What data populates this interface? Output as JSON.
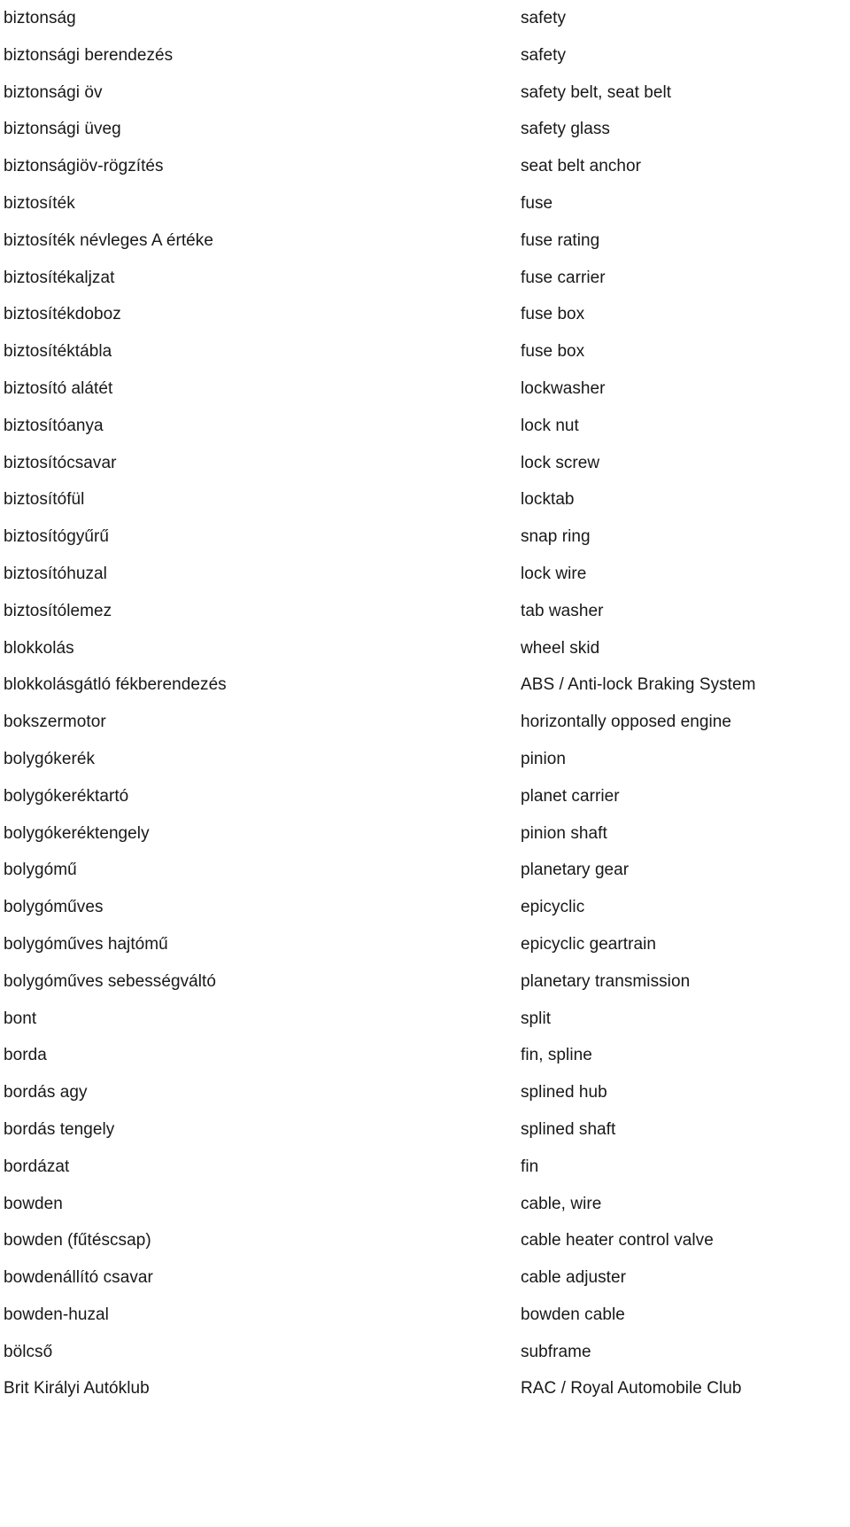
{
  "document": {
    "type": "bilingual-glossary",
    "columns": [
      {
        "key": "source",
        "language": "Hungarian"
      },
      {
        "key": "target",
        "language": "English"
      }
    ],
    "entries": [
      {
        "source": "biztonság",
        "target": "safety"
      },
      {
        "source": "biztonsági berendezés",
        "target": "safety"
      },
      {
        "source": "biztonsági öv",
        "target": "safety belt, seat belt"
      },
      {
        "source": "biztonsági üveg",
        "target": "safety glass"
      },
      {
        "source": "biztonságiöv-rögzítés",
        "target": "seat belt anchor"
      },
      {
        "source": "biztosíték",
        "target": "fuse"
      },
      {
        "source": "biztosíték névleges A értéke",
        "target": "fuse rating"
      },
      {
        "source": "biztosítékaljzat",
        "target": "fuse carrier"
      },
      {
        "source": "biztosítékdoboz",
        "target": "fuse box"
      },
      {
        "source": "biztosítéktábla",
        "target": "fuse box"
      },
      {
        "source": "biztosító alátét",
        "target": "lockwasher"
      },
      {
        "source": "biztosítóanya",
        "target": "lock nut"
      },
      {
        "source": "biztosítócsavar",
        "target": "lock screw"
      },
      {
        "source": "biztosítófül",
        "target": "locktab"
      },
      {
        "source": "biztosítógyűrű",
        "target": "snap ring"
      },
      {
        "source": "biztosítóhuzal",
        "target": "lock wire"
      },
      {
        "source": "biztosítólemez",
        "target": "tab washer"
      },
      {
        "source": "blokkolás",
        "target": "wheel skid"
      },
      {
        "source": "blokkolásgátló fékberendezés",
        "target": "ABS / Anti-lock Braking System"
      },
      {
        "source": "bokszermotor",
        "target": "horizontally opposed engine"
      },
      {
        "source": "bolygókerék",
        "target": "pinion"
      },
      {
        "source": "bolygókeréktartó",
        "target": "planet carrier"
      },
      {
        "source": "bolygókeréktengely",
        "target": "pinion shaft"
      },
      {
        "source": "bolygómű",
        "target": "planetary gear"
      },
      {
        "source": "bolygóműves",
        "target": "epicyclic"
      },
      {
        "source": "bolygóműves hajtómű",
        "target": "epicyclic geartrain"
      },
      {
        "source": "bolygóműves sebességváltó",
        "target": "planetary transmission"
      },
      {
        "source": "bont",
        "target": "split"
      },
      {
        "source": "borda",
        "target": "fin, spline"
      },
      {
        "source": "bordás agy",
        "target": "splined hub"
      },
      {
        "source": "bordás tengely",
        "target": "splined shaft"
      },
      {
        "source": "bordázat",
        "target": "fin"
      },
      {
        "source": "bowden",
        "target": "cable, wire"
      },
      {
        "source": "bowden (fűtéscsap)",
        "target": "cable heater control valve"
      },
      {
        "source": "bowdenállító csavar",
        "target": "cable adjuster"
      },
      {
        "source": "bowden-huzal",
        "target": "bowden cable"
      },
      {
        "source": "bölcső",
        "target": "subframe"
      },
      {
        "source": "Brit Királyi Autóklub",
        "target": "RAC / Royal Automobile Club"
      }
    ]
  }
}
